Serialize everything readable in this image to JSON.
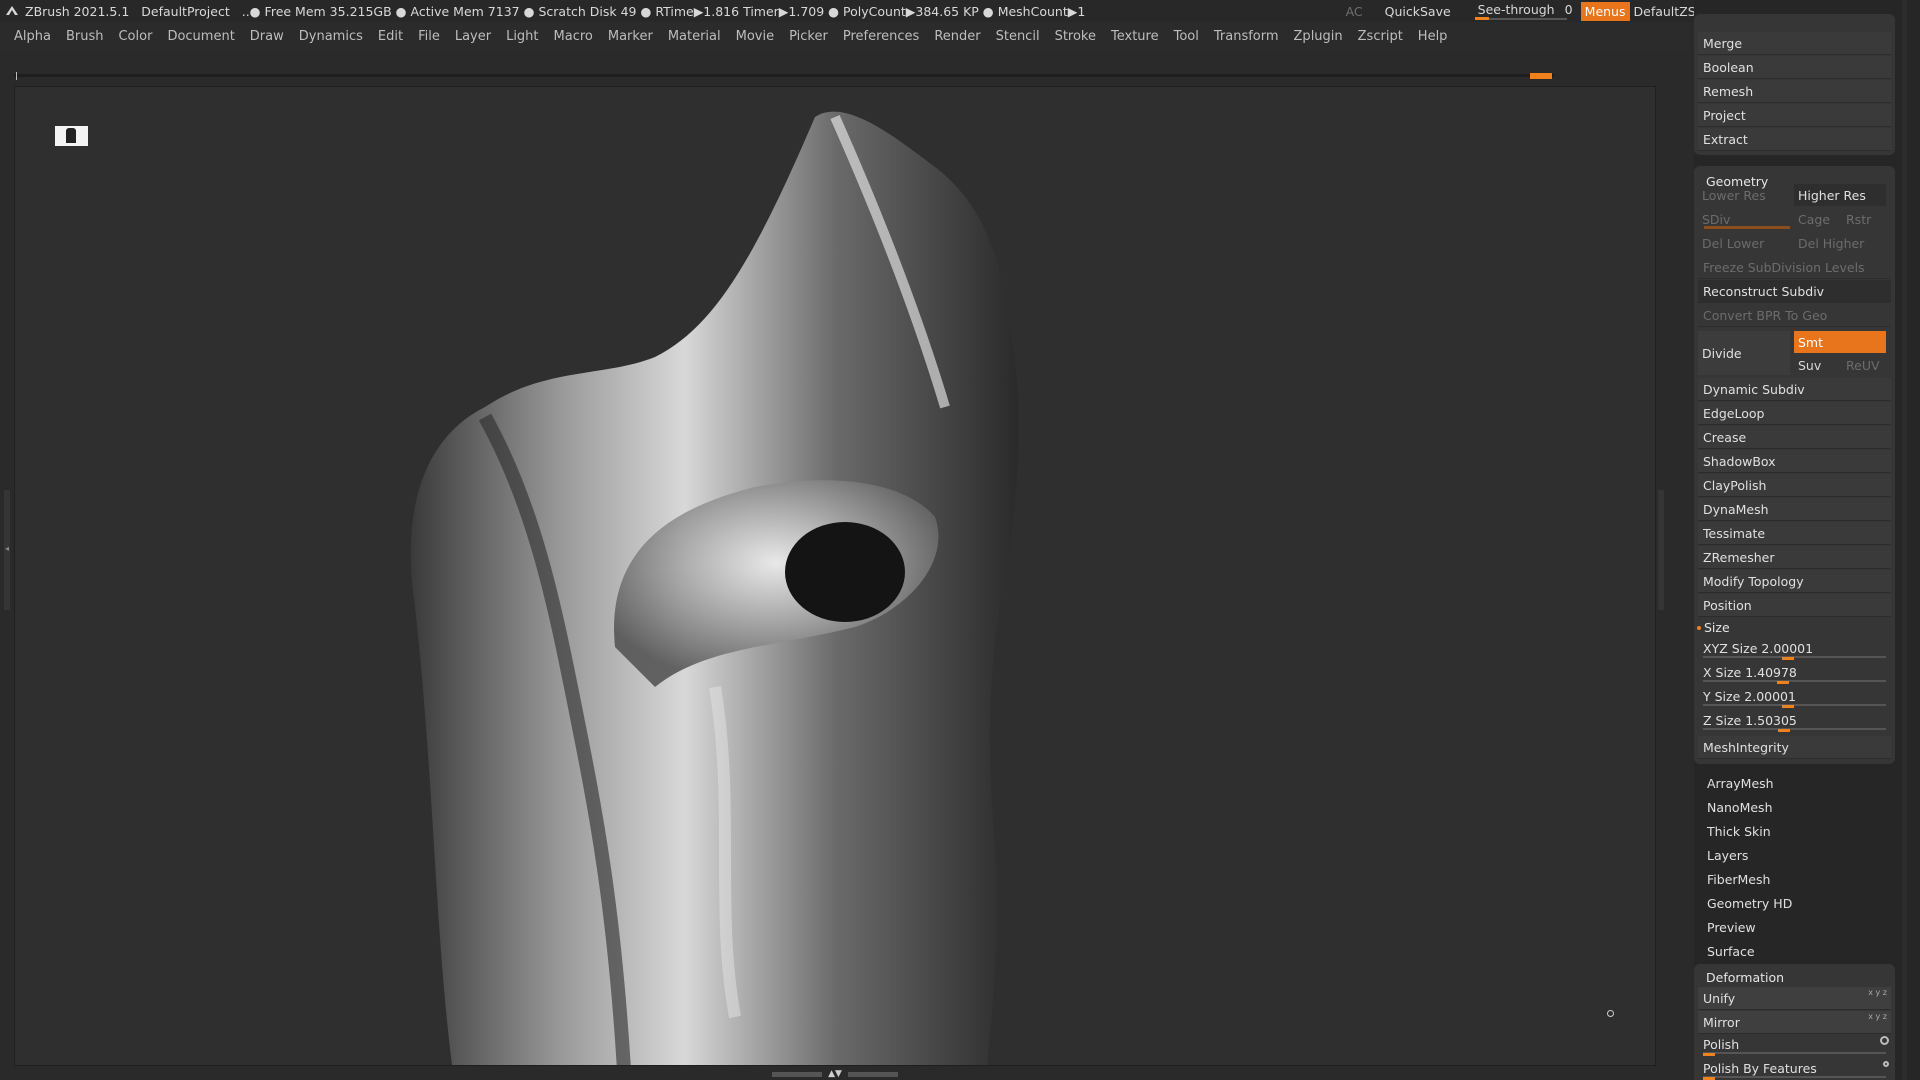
{
  "titlebar": {
    "app": "ZBrush 2021.5.1",
    "project": "DefaultProject",
    "status": "..● Free Mem 35.215GB ● Active Mem 7137 ● Scratch Disk 49 ●  RTime▶1.816 Timer▶1.709 ● PolyCount▶384.65 KP  ● MeshCount▶1",
    "ac": "AC",
    "quicksave": "QuickSave",
    "see_through_label": "See-through",
    "see_through_value": "0",
    "menus": "Menus",
    "script": "DefaultZScript"
  },
  "menubar": {
    "items": [
      "Alpha",
      "Brush",
      "Color",
      "Document",
      "Draw",
      "Dynamics",
      "Edit",
      "File",
      "Layer",
      "Light",
      "Macro",
      "Marker",
      "Material",
      "Movie",
      "Picker",
      "Preferences",
      "Render",
      "Stencil",
      "Stroke",
      "Texture",
      "Tool",
      "Transform",
      "Zplugin",
      "Zscript",
      "Help"
    ]
  },
  "tray": {
    "top_buttons": [
      "Merge",
      "Boolean",
      "Remesh",
      "Project",
      "Extract"
    ],
    "geometry": {
      "title": "Geometry",
      "lower_res": "Lower Res",
      "higher_res": "Higher Res",
      "sdiv": "SDiv",
      "cage": "Cage",
      "rstr": "Rstr",
      "del_lower": "Del Lower",
      "del_higher": "Del Higher",
      "freeze": "Freeze SubDivision Levels",
      "reconstruct": "Reconstruct Subdiv",
      "convert_bpr": "Convert BPR To Geo",
      "divide": "Divide",
      "smt": "Smt",
      "suv": "Suv",
      "reuv": "ReUV",
      "subitems": [
        "Dynamic Subdiv",
        "EdgeLoop",
        "Crease",
        "ShadowBox",
        "ClayPolish",
        "DynaMesh",
        "Tessimate",
        "ZRemesher",
        "Modify Topology",
        "Position"
      ],
      "size_title": "Size",
      "sizes": [
        {
          "label": "XYZ Size",
          "value": "2.00001"
        },
        {
          "label": "X Size",
          "value": "1.40978"
        },
        {
          "label": "Y Size",
          "value": "2.00001"
        },
        {
          "label": "Z Size",
          "value": "1.50305"
        }
      ],
      "mesh_integrity": "MeshIntegrity"
    },
    "subpalettes": [
      "ArrayMesh",
      "NanoMesh",
      "Thick Skin",
      "Layers",
      "FiberMesh",
      "Geometry HD",
      "Preview",
      "Surface"
    ],
    "deformation": {
      "title": "Deformation",
      "items": [
        "Unify",
        "Mirror",
        "Polish",
        "Polish By Features"
      ]
    }
  }
}
